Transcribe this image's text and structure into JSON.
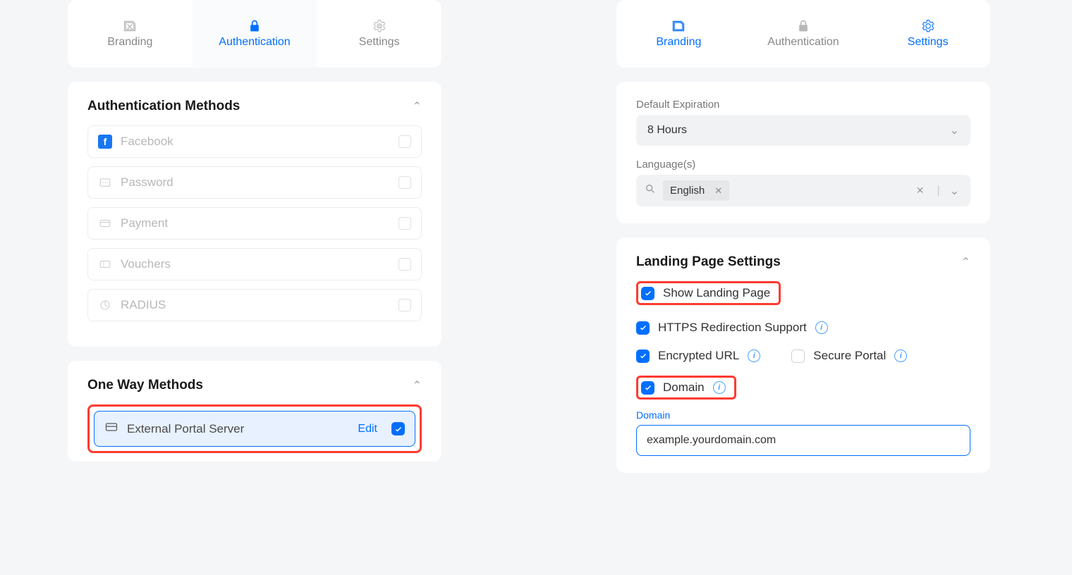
{
  "tabs": {
    "branding": "Branding",
    "authentication": "Authentication",
    "settings": "Settings"
  },
  "left": {
    "auth_methods_title": "Authentication Methods",
    "methods": {
      "facebook": "Facebook",
      "password": "Password",
      "payment": "Payment",
      "vouchers": "Vouchers",
      "radius": "RADIUS"
    },
    "one_way_title": "One Way Methods",
    "external_portal": "External Portal Server",
    "edit": "Edit"
  },
  "right": {
    "default_expiration_label": "Default Expiration",
    "default_expiration_value": "8 Hours",
    "languages_label": "Language(s)",
    "languages_value": "English",
    "landing_title": "Landing Page Settings",
    "show_landing": "Show Landing Page",
    "https_redir": "HTTPS Redirection Support",
    "encrypted_url": "Encrypted URL",
    "secure_portal": "Secure Portal",
    "domain_cb": "Domain",
    "domain_label": "Domain",
    "domain_value": "example.yourdomain.com"
  }
}
